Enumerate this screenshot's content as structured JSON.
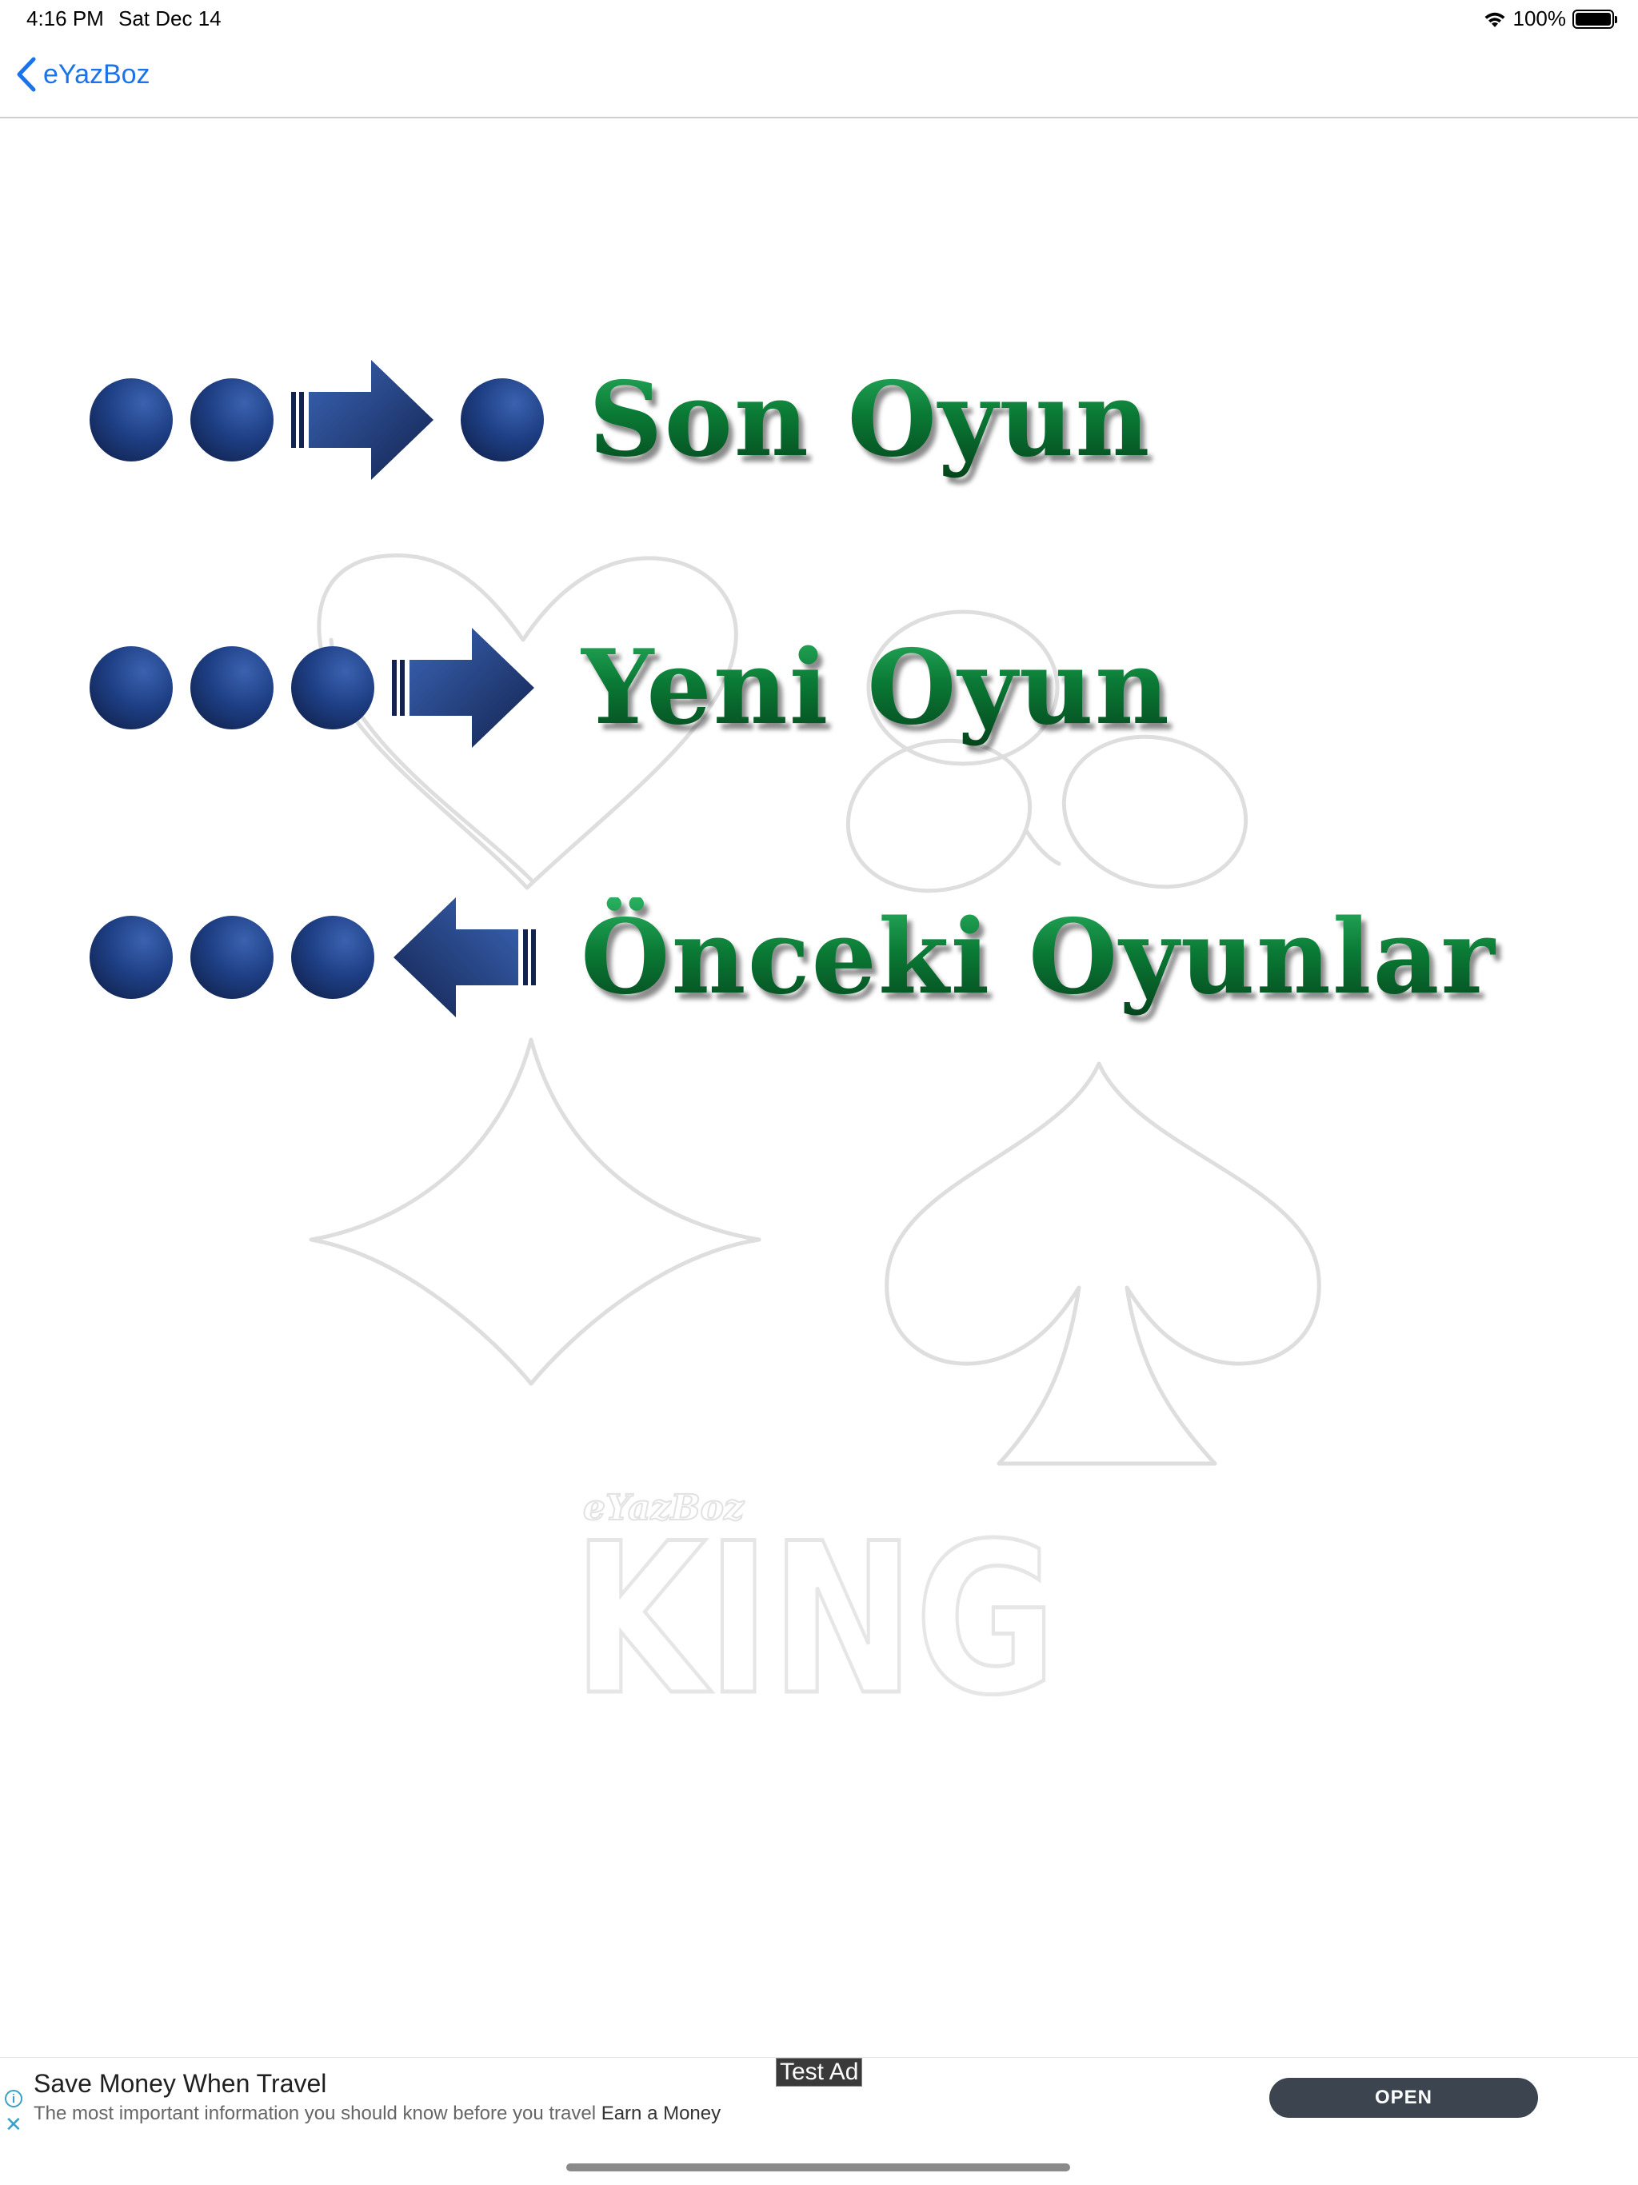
{
  "status_bar": {
    "time": "4:16 PM",
    "date": "Sat Dec 14",
    "battery": "100%"
  },
  "nav": {
    "back_label": "eYazBoz"
  },
  "menu": {
    "items": [
      {
        "label": "Son Oyun",
        "dots": 3,
        "arrow": "right"
      },
      {
        "label": "Yeni Oyun",
        "dots": 3,
        "arrow": "right"
      },
      {
        "label": "Önceki Oyunlar",
        "dots": 3,
        "arrow": "left"
      }
    ]
  },
  "watermark": {
    "brand": "eYazBoz",
    "word": "KING"
  },
  "ad": {
    "title": "Save Money When Travel",
    "description": "The most important information you should know before you travel",
    "advertiser": "Earn a Money",
    "badge": "Test Ad",
    "cta": "OPEN"
  },
  "colors": {
    "accent": "#1a73e8",
    "label_green": "#0c7a36",
    "dot_blue": "#1e3f85"
  }
}
